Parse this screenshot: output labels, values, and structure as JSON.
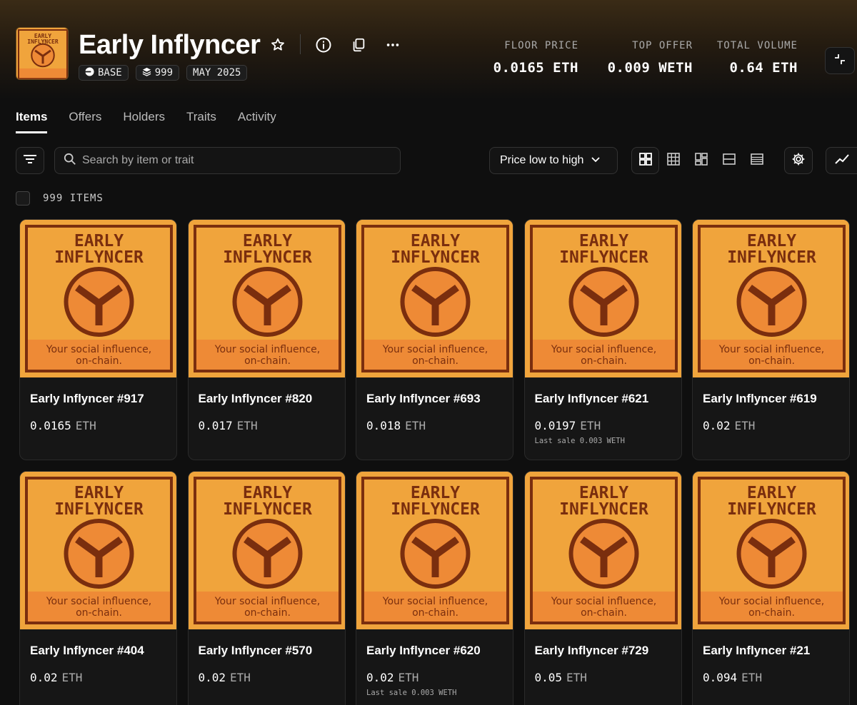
{
  "collection": {
    "title": "Early Inflyncer",
    "badges": [
      {
        "icon": "base-chain-icon",
        "label": "BASE"
      },
      {
        "icon": "layers-icon",
        "label": "999"
      },
      {
        "icon": "",
        "label": "MAY 2025"
      }
    ]
  },
  "artwork": {
    "line1": "EARLY",
    "line2": "INFLYNCER",
    "tagline1": "Your social influence,",
    "tagline2": "on-chain."
  },
  "stats": [
    {
      "label": "FLOOR PRICE",
      "value": "0.0165 ETH"
    },
    {
      "label": "TOP OFFER",
      "value": "0.009 WETH"
    },
    {
      "label": "TOTAL VOLUME",
      "value": "0.64 ETH"
    }
  ],
  "tabs": [
    "Items",
    "Offers",
    "Holders",
    "Traits",
    "Activity"
  ],
  "active_tab": "Items",
  "toolbar": {
    "search_placeholder": "Search by item or trait",
    "sort_label": "Price low to high"
  },
  "items_count_label": "999 ITEMS",
  "items": [
    {
      "name": "Early Inflyncer #917",
      "price": "0.0165",
      "unit": "ETH",
      "last_sale": ""
    },
    {
      "name": "Early Inflyncer #820",
      "price": "0.017",
      "unit": "ETH",
      "last_sale": ""
    },
    {
      "name": "Early Inflyncer #693",
      "price": "0.018",
      "unit": "ETH",
      "last_sale": ""
    },
    {
      "name": "Early Inflyncer #621",
      "price": "0.0197",
      "unit": "ETH",
      "last_sale": "Last sale 0.003 WETH"
    },
    {
      "name": "Early Inflyncer #619",
      "price": "0.02",
      "unit": "ETH",
      "last_sale": ""
    },
    {
      "name": "Early Inflyncer #404",
      "price": "0.02",
      "unit": "ETH",
      "last_sale": ""
    },
    {
      "name": "Early Inflyncer #570",
      "price": "0.02",
      "unit": "ETH",
      "last_sale": ""
    },
    {
      "name": "Early Inflyncer #620",
      "price": "0.02",
      "unit": "ETH",
      "last_sale": "Last sale 0.003 WETH"
    },
    {
      "name": "Early Inflyncer #729",
      "price": "0.05",
      "unit": "ETH",
      "last_sale": ""
    },
    {
      "name": "Early Inflyncer #21",
      "price": "0.094",
      "unit": "ETH",
      "last_sale": ""
    }
  ],
  "colors": {
    "art_bg": "#f0a43c",
    "art_ink": "#7a2e0e",
    "art_orange": "#ee8a36"
  }
}
